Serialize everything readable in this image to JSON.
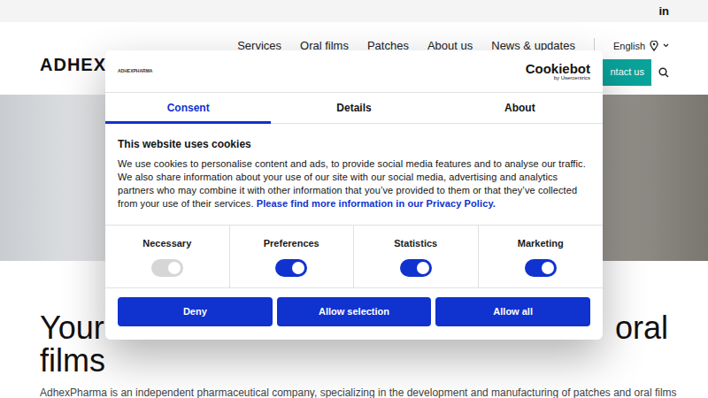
{
  "topbar": {
    "linkedin": "in"
  },
  "header": {
    "logo": "ADHEX",
    "nav": [
      "Services",
      "Oral films",
      "Patches",
      "About us",
      "News & updates"
    ],
    "language": "English",
    "contact": "ntact us"
  },
  "hero": {
    "headline_left": "Your",
    "headline_right": "oral",
    "headline_line2": "films",
    "paragraph": "AdhexPharma is an independent pharmaceutical company, specializing in the development and manufacturing of patches and oral films"
  },
  "cookie": {
    "logo": "ADHEXPHARMA",
    "brand": "Cookiebot",
    "brand_sub": "by Usercentrics",
    "tabs": [
      {
        "label": "Consent",
        "selected": true
      },
      {
        "label": "Details",
        "selected": false
      },
      {
        "label": "About",
        "selected": false
      }
    ],
    "title": "This website uses cookies",
    "body": "We use cookies to personalise content and ads, to provide social media features and to analyse our traffic. We also share information about your use of our site with our social media, advertising and analytics partners who may combine it with other information that you’ve provided to them or that they’ve collected from your use of their services. ",
    "link": "Please find more information in our Privacy Policy.",
    "toggles": [
      {
        "label": "Necessary",
        "on": true,
        "disabled": true
      },
      {
        "label": "Preferences",
        "on": true,
        "disabled": false
      },
      {
        "label": "Statistics",
        "on": true,
        "disabled": false
      },
      {
        "label": "Marketing",
        "on": true,
        "disabled": false
      }
    ],
    "buttons": [
      "Deny",
      "Allow selection",
      "Allow all"
    ]
  }
}
